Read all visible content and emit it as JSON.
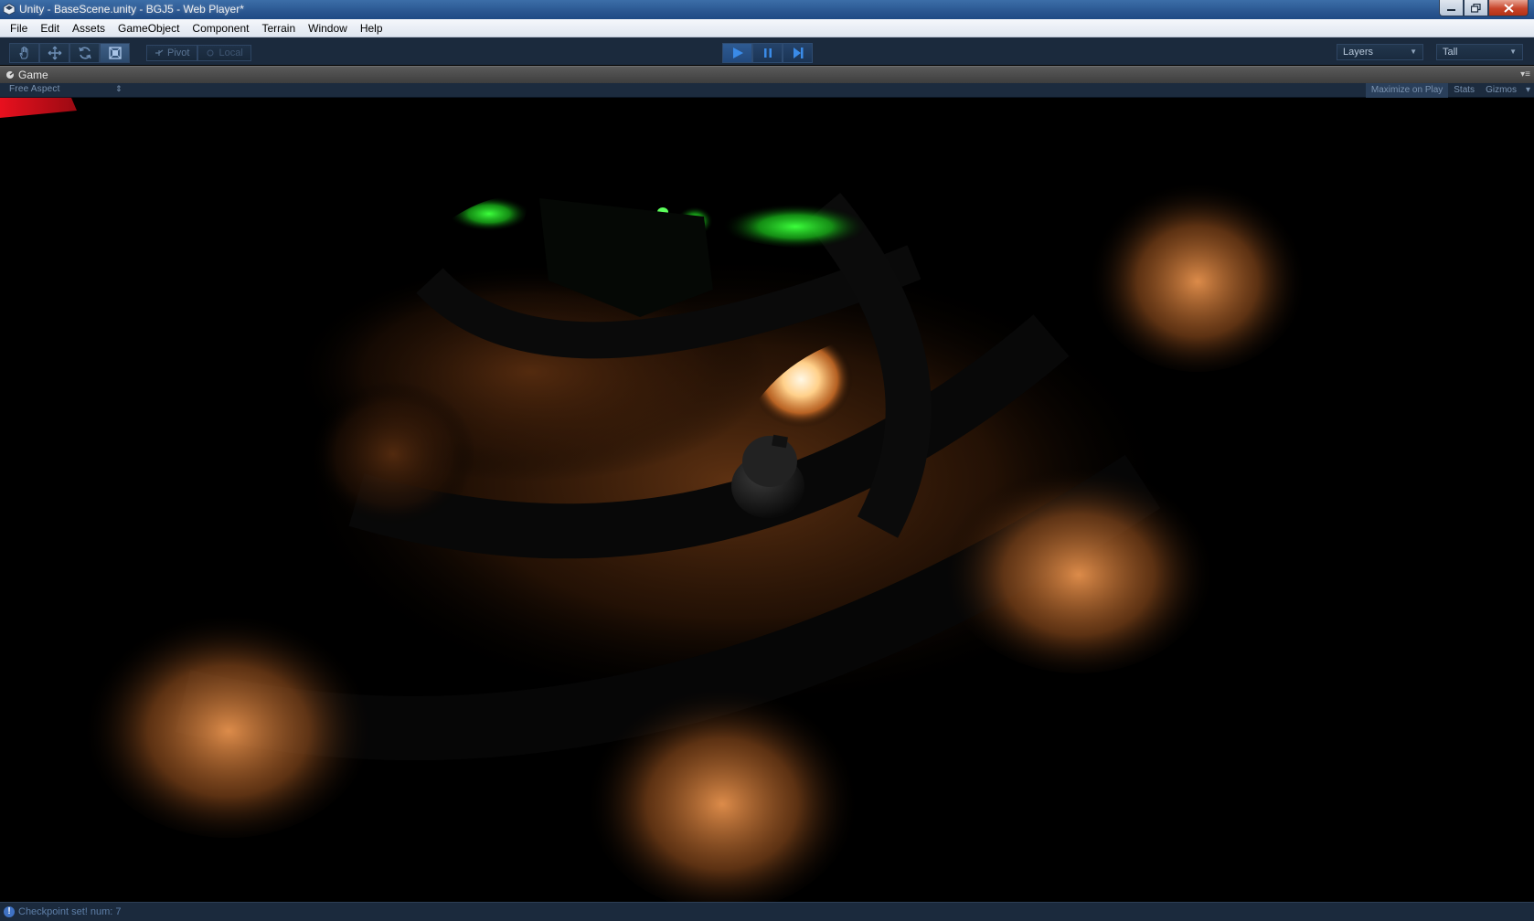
{
  "window": {
    "title": "Unity - BaseScene.unity - BGJ5 - Web Player*"
  },
  "menu": [
    "File",
    "Edit",
    "Assets",
    "GameObject",
    "Component",
    "Terrain",
    "Window",
    "Help"
  ],
  "toolbar": {
    "tools": [
      "hand-icon",
      "move-icon",
      "rotate-icon",
      "scale-icon"
    ],
    "pivot_label": "Pivot",
    "local_label": "Local",
    "layers_label": "Layers",
    "layout_label": "Tall"
  },
  "game_panel": {
    "tab_label": "Game",
    "aspect_label": "Free Aspect",
    "maximize_label": "Maximize on Play",
    "stats_label": "Stats",
    "gizmos_label": "Gizmos"
  },
  "status": {
    "message": "Checkpoint set! num: 7"
  },
  "colors": {
    "accent": "#2e5a92",
    "glow_orange": "#e8934e",
    "glow_green": "#19d419",
    "marker_red": "#e8101e"
  }
}
